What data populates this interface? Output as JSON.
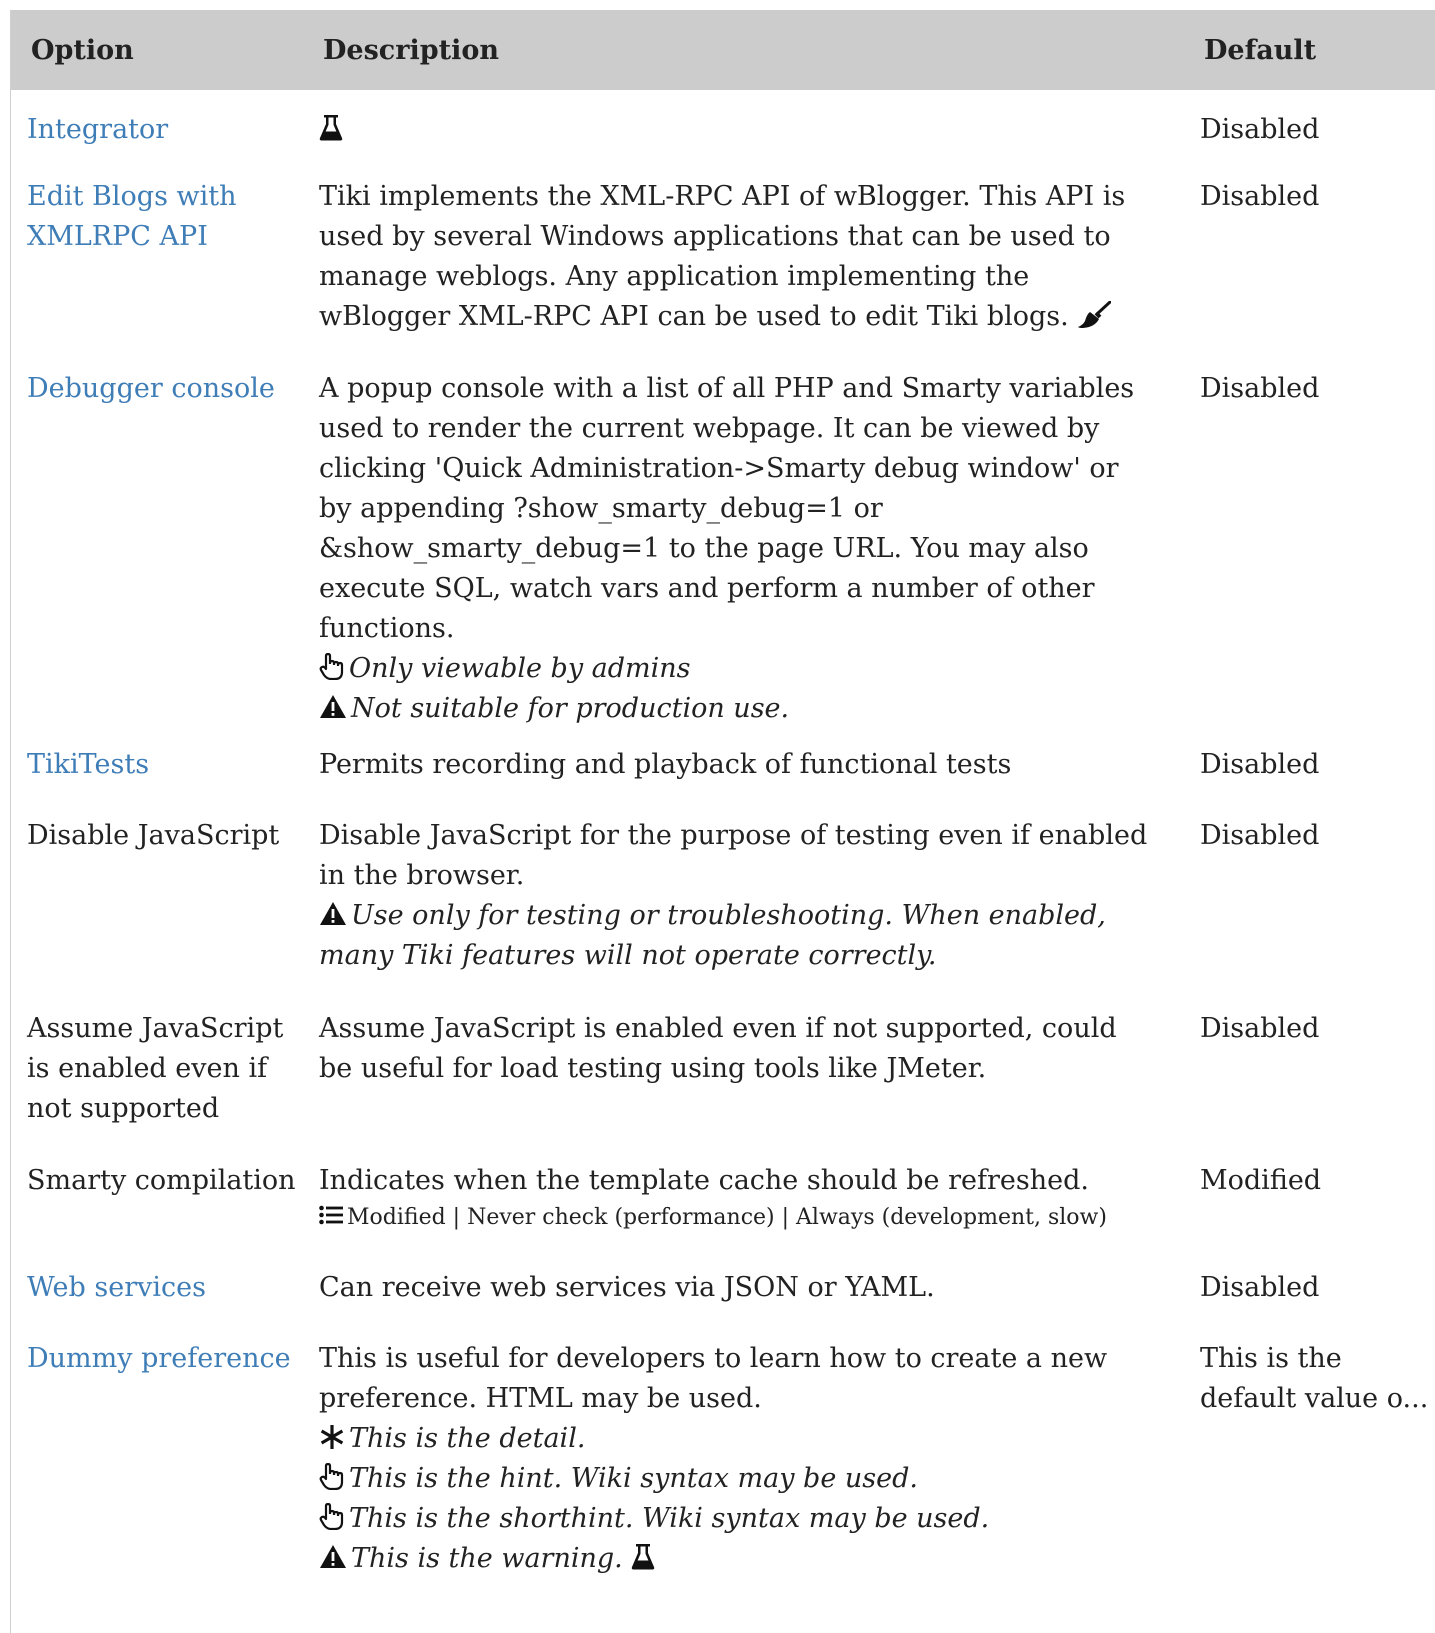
{
  "headers": {
    "option": "Option",
    "description": "Description",
    "default": "Default"
  },
  "rows": [
    {
      "option": "Integrator",
      "option_is_link": true,
      "description": "",
      "default": "Disabled",
      "icons": [
        "flask-icon"
      ]
    },
    {
      "option": "Edit Blogs with XMLRPC API",
      "option_is_link": true,
      "description": "Tiki implements the XML-RPC API of wBlogger. This API is used by several Windows applications that can be used to manage weblogs. Any application implementing the wBlogger XML-RPC API can be used to edit Tiki blogs.",
      "default": "Disabled",
      "icons": [
        "broom-icon"
      ]
    },
    {
      "option": "Debugger console",
      "option_is_link": true,
      "description": "A popup console with a list of all PHP and Smarty variables used to render the current webpage. It can be viewed by clicking 'Quick Administration->Smarty debug window' or by appending ?show_smarty_debug=1 or &show_smarty_debug=1 to the page URL. You may also execute SQL, watch vars and perform a number of other functions.",
      "hint": "Only viewable by admins",
      "warning": "Not suitable for production use.",
      "default": "Disabled"
    },
    {
      "option": "TikiTests",
      "option_is_link": true,
      "description": "Permits recording and playback of functional tests",
      "default": "Disabled"
    },
    {
      "option": "Disable JavaScript",
      "option_is_link": false,
      "description": "Disable JavaScript for the purpose of testing even if enabled in the browser.",
      "warning": "Use only for testing or troubleshooting. When enabled, many Tiki features will not operate correctly.",
      "default": "Disabled"
    },
    {
      "option": "Assume JavaScript is enabled even if not supported",
      "option_is_link": false,
      "description": "Assume JavaScript is enabled even if not supported, could be useful for load testing using tools like JMeter.",
      "default": "Disabled"
    },
    {
      "option": "Smarty compilation",
      "option_is_link": false,
      "description": "Indicates when the template cache should be refreshed.",
      "options_list": "Modified | Never check (performance) | Always (development, slow)",
      "default": "Modified"
    },
    {
      "option": "Web services",
      "option_is_link": true,
      "description": "Can receive web services via JSON or YAML.",
      "default": "Disabled"
    },
    {
      "option": "Dummy preference",
      "option_is_link": true,
      "description": "This is useful for developers to learn how to create a new preference. HTML may be used.",
      "detail": "This is the detail.",
      "hint": "This is the hint. Wiki syntax may be used.",
      "shorthint": "This is the shorthint. Wiki syntax may be used.",
      "warning": "This is the warning.",
      "default": "This is the default value o..."
    }
  ],
  "colors": {
    "link": "#3f7db7",
    "header_bg": "#cccccc",
    "text": "#222222"
  }
}
